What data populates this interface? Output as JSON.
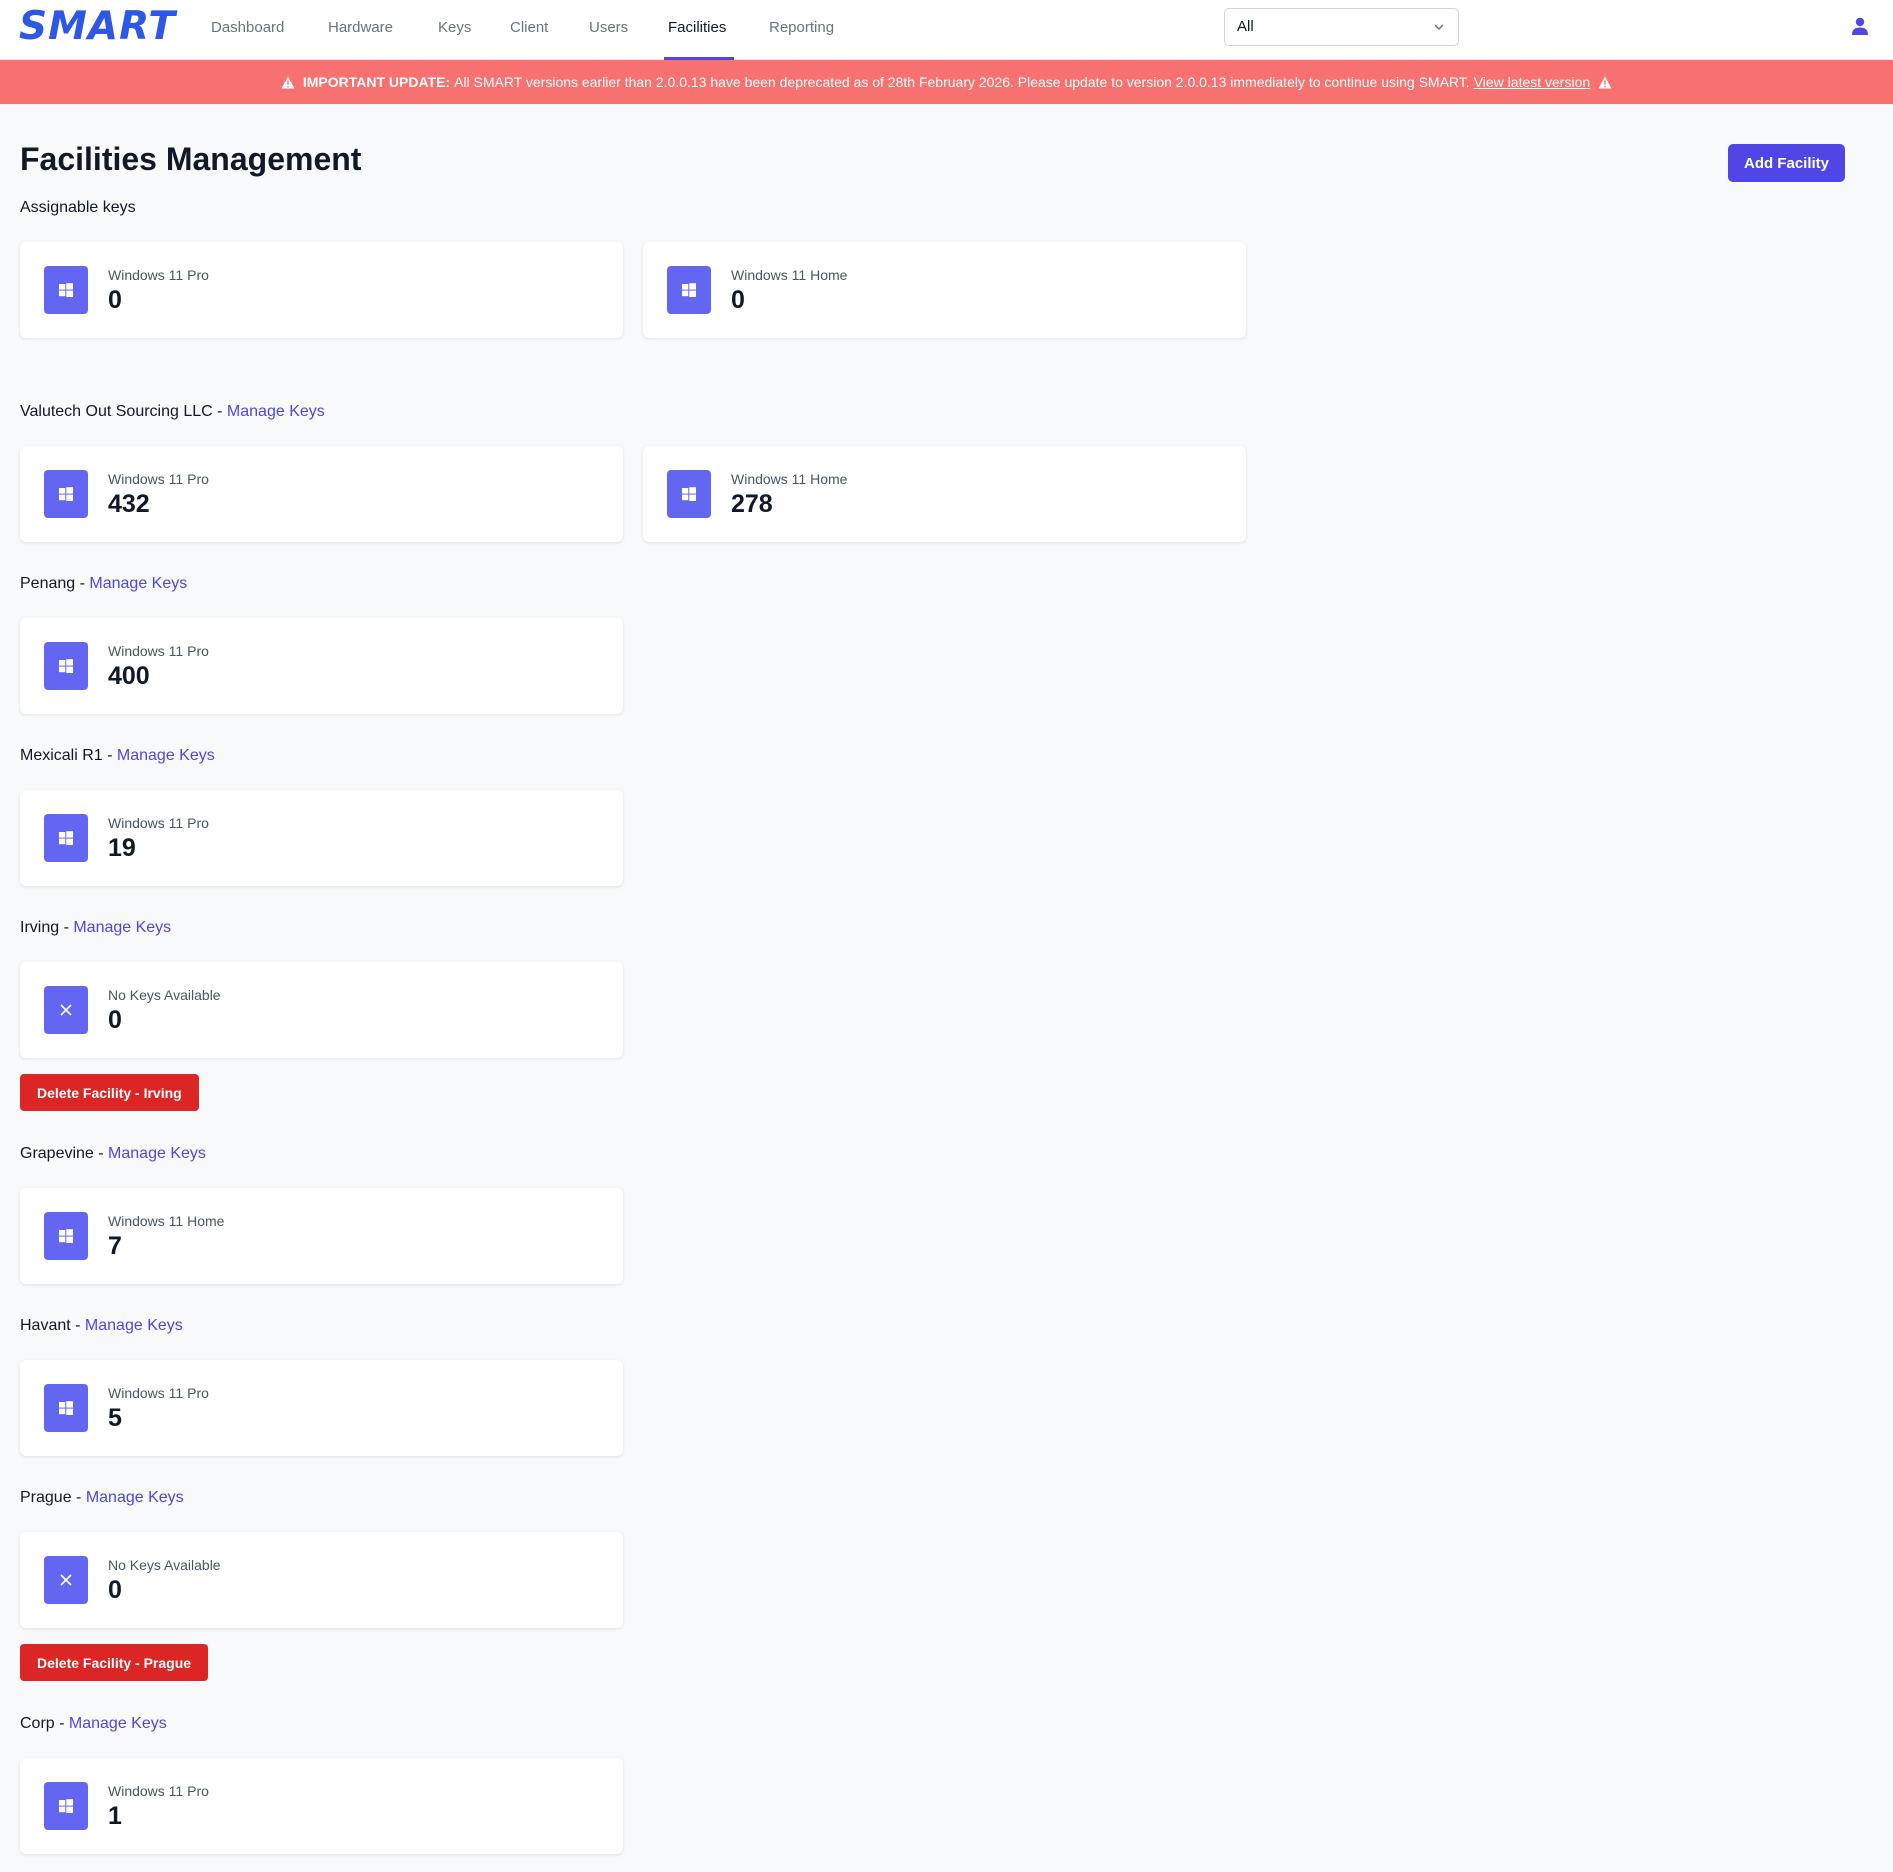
{
  "brand": {
    "logo_text": "SMART",
    "accent": "#4f46e5",
    "logo_color": "#2d58e6"
  },
  "nav": {
    "items": [
      "Dashboard",
      "Hardware",
      "Keys",
      "Client",
      "Users",
      "Facilities",
      "Reporting"
    ],
    "active": "Facilities"
  },
  "filter": {
    "selected": "All"
  },
  "banner": {
    "bold": "IMPORTANT UPDATE:",
    "message": "All SMART versions earlier than 2.0.0.13 have been deprecated as of 28th February 2026. Please update to version 2.0.0.13 immediately to continue using SMART.",
    "link": "View latest version",
    "color": "#f87171"
  },
  "page": {
    "title": "Facilities Management",
    "add_button": "Add Facility"
  },
  "assignable": {
    "label": "Assignable keys",
    "cards": [
      {
        "label": "Windows 11 Pro",
        "value": "0",
        "icon": "windows-icon"
      },
      {
        "label": "Windows 11 Home",
        "value": "0",
        "icon": "windows-icon"
      }
    ]
  },
  "facilities": [
    {
      "name": "Valutech Out Sourcing LLC",
      "sep": " - ",
      "link": "Manage Keys",
      "cards": [
        {
          "label": "Windows 11 Pro",
          "value": "432",
          "icon": "windows-icon"
        },
        {
          "label": "Windows 11 Home",
          "value": "278",
          "icon": "windows-icon"
        }
      ]
    },
    {
      "name": "Penang",
      "sep": " - ",
      "link": "Manage Keys",
      "cards": [
        {
          "label": "Windows 11 Pro",
          "value": "400",
          "icon": "windows-icon"
        }
      ]
    },
    {
      "name": "Mexicali R1",
      "sep": " - ",
      "link": "Manage Keys",
      "cards": [
        {
          "label": "Windows 11 Pro",
          "value": "19",
          "icon": "windows-icon"
        }
      ]
    },
    {
      "name": "Irving",
      "sep": " - ",
      "link": "Manage Keys",
      "cards": [
        {
          "label": "No Keys Available",
          "value": "0",
          "icon": "close-icon"
        }
      ],
      "delete_label": "Delete Facility - Irving"
    },
    {
      "name": "Grapevine",
      "sep": " - ",
      "link": "Manage Keys",
      "cards": [
        {
          "label": "Windows 11 Home",
          "value": "7",
          "icon": "windows-icon"
        }
      ]
    },
    {
      "name": "Havant",
      "sep": " - ",
      "link": "Manage Keys",
      "cards": [
        {
          "label": "Windows 11 Pro",
          "value": "5",
          "icon": "windows-icon"
        }
      ]
    },
    {
      "name": "Prague",
      "sep": " - ",
      "link": "Manage Keys",
      "cards": [
        {
          "label": "No Keys Available",
          "value": "0",
          "icon": "close-icon"
        }
      ],
      "delete_label": "Delete Facility - Prague"
    },
    {
      "name": "Corp",
      "sep": " - ",
      "link": "Manage Keys",
      "cards": [
        {
          "label": "Windows 11 Pro",
          "value": "1",
          "icon": "windows-icon"
        }
      ]
    }
  ]
}
